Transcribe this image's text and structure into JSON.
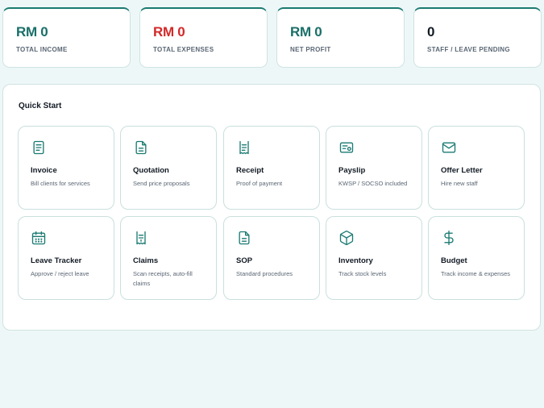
{
  "stats": [
    {
      "value": "RM 0",
      "label": "TOTAL INCOME",
      "color": "#1a6f69"
    },
    {
      "value": "RM 0",
      "label": "TOTAL EXPENSES",
      "color": "#d22a2a"
    },
    {
      "value": "RM 0",
      "label": "NET PROFIT",
      "color": "#1a6f69"
    },
    {
      "value": "0",
      "label": "STAFF / LEAVE PENDING",
      "color": "#141c26"
    }
  ],
  "quick_start": {
    "title": "Quick Start",
    "items": [
      {
        "icon": "invoice-icon",
        "title": "Invoice",
        "desc": "Bill clients for services"
      },
      {
        "icon": "quotation-icon",
        "title": "Quotation",
        "desc": "Send price proposals"
      },
      {
        "icon": "receipt-icon",
        "title": "Receipt",
        "desc": "Proof of payment"
      },
      {
        "icon": "payslip-icon",
        "title": "Payslip",
        "desc": "KWSP / SOCSO included"
      },
      {
        "icon": "mail-icon",
        "title": "Offer Letter",
        "desc": "Hire new staff"
      },
      {
        "icon": "calendar-icon",
        "title": "Leave Tracker",
        "desc": "Approve / reject leave"
      },
      {
        "icon": "claims-icon",
        "title": "Claims",
        "desc": "Scan receipts, auto-fill claims"
      },
      {
        "icon": "document-icon",
        "title": "SOP",
        "desc": "Standard procedures"
      },
      {
        "icon": "box-icon",
        "title": "Inventory",
        "desc": "Track stock levels"
      },
      {
        "icon": "dollar-icon",
        "title": "Budget",
        "desc": "Track income & expenses"
      }
    ]
  },
  "colors": {
    "accent": "#1a7a72"
  }
}
